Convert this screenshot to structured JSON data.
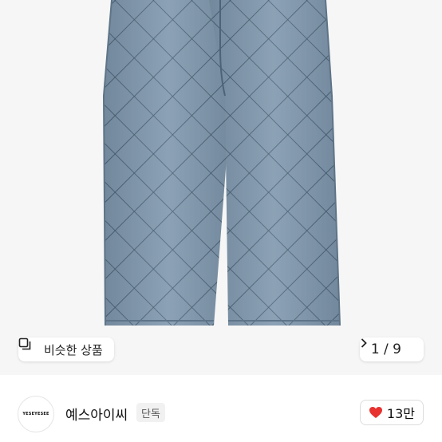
{
  "similar_products": {
    "label": "비슷한 상품",
    "icon": "similar-items-icon"
  },
  "pager": {
    "text": "1 / 9",
    "icon": "chevron-right-icon"
  },
  "shop": {
    "avatar_text": "YESEYESEE",
    "name": "예스아이씨",
    "badge": "단독"
  },
  "likes": {
    "count": "13만",
    "icon": "heart-icon",
    "color": "#e8322f"
  },
  "colors": {
    "denim": "#7f97ad",
    "stitch": "#3f566b",
    "background": "#f6f6f6"
  }
}
